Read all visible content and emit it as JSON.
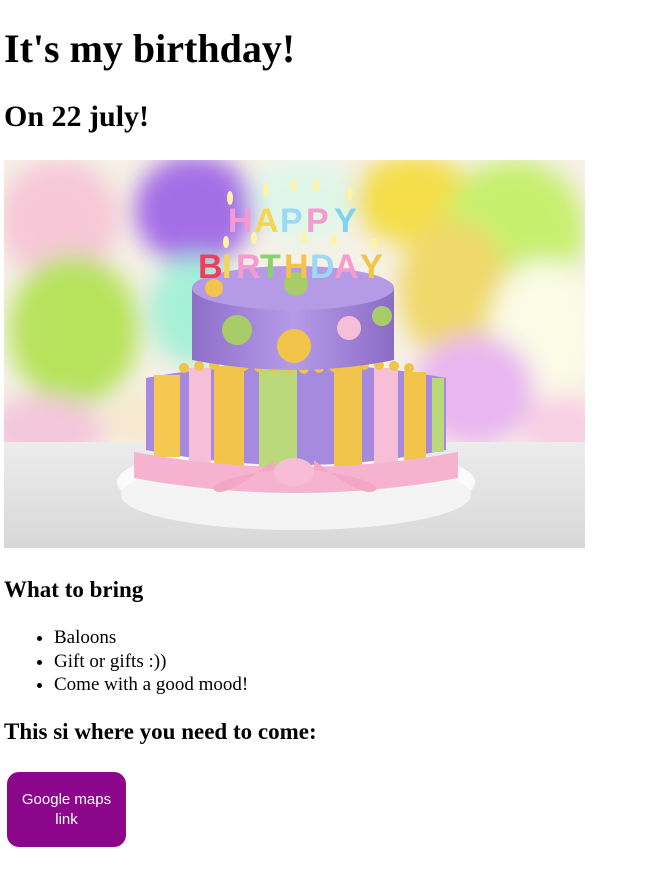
{
  "page": {
    "title": "It's my birthday!",
    "date_heading": "On 22 july!",
    "hero_image": {
      "cake_topper_text": "HAPPY BIRTHDAY",
      "theme_colors": [
        "#a98be0",
        "#f4c95a",
        "#f7a8c8",
        "#b8e986"
      ]
    },
    "bring_heading": "What to bring",
    "bring_items": [
      "Baloons",
      "Gift or gifts :))",
      "Come with a good mood!"
    ],
    "location_heading": "This si where you need to come:",
    "maps_button": {
      "label": "Google maps link",
      "color": "#8b068b"
    }
  }
}
